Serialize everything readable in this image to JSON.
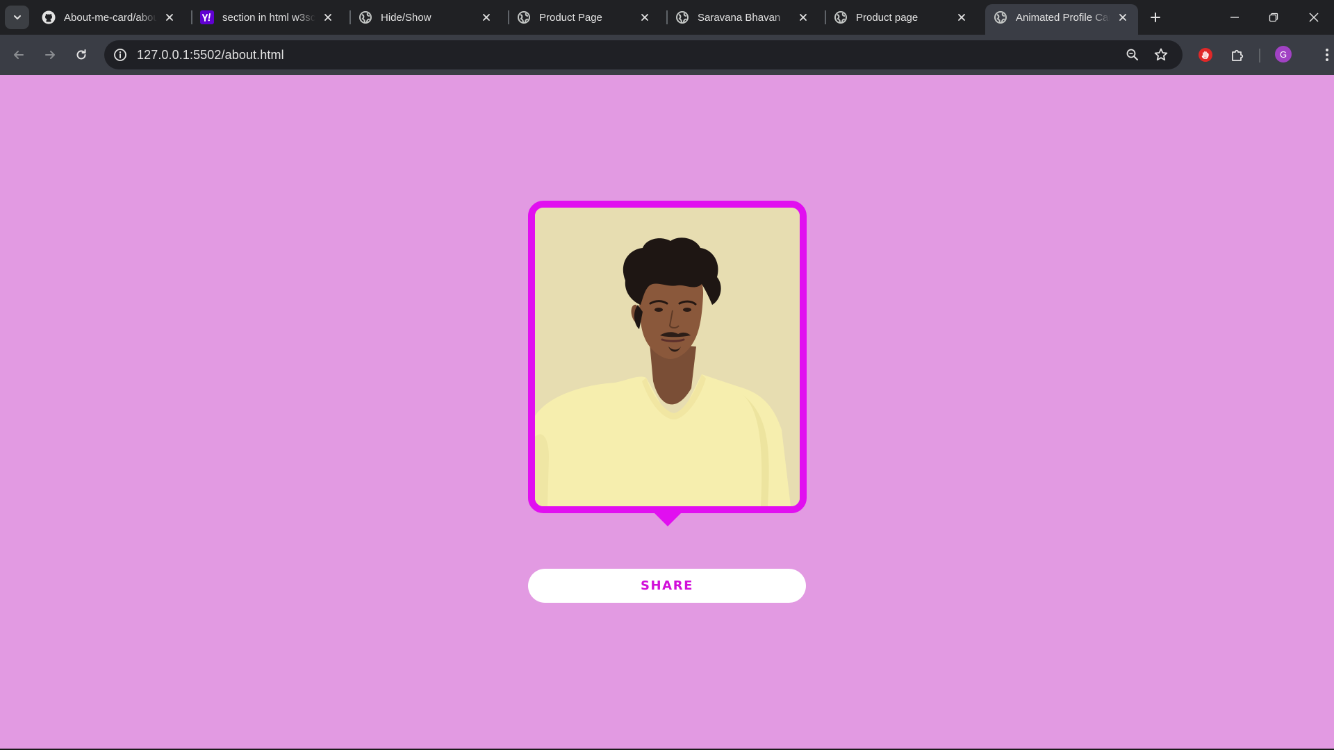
{
  "browser": {
    "tabs": [
      {
        "title": "About-me-card/abou",
        "icon": "github-icon"
      },
      {
        "title": "section in html w3sch",
        "icon": "yahoo-icon"
      },
      {
        "title": "Hide/Show",
        "icon": "globe-icon"
      },
      {
        "title": "Product Page",
        "icon": "globe-icon"
      },
      {
        "title": "Saravana Bhavan",
        "icon": "globe-icon"
      },
      {
        "title": "Product page",
        "icon": "globe-icon"
      },
      {
        "title": "Animated Profile Car",
        "icon": "globe-icon",
        "active": true
      }
    ],
    "url": "127.0.0.1:5502/about.html",
    "profile_initial": "G"
  },
  "colors": {
    "page_background": "#e29ae2",
    "card_border": "#e10ff0",
    "share_text": "#d10ed9",
    "photo_background": "#e7ddb1"
  },
  "page": {
    "profile_photo": "portrait-photo",
    "share_label": "SHARE"
  }
}
